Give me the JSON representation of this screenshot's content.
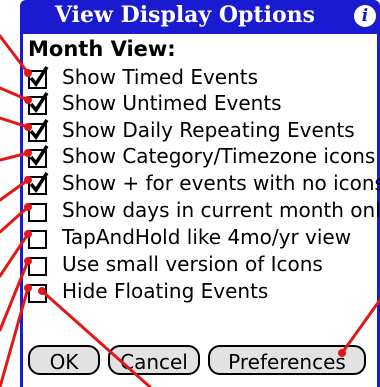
{
  "dialog": {
    "title": "View Display Options",
    "info_glyph": "i",
    "section_label": "Month View:"
  },
  "options": [
    {
      "label": "Show Timed Events",
      "checked": true
    },
    {
      "label": "Show Untimed Events",
      "checked": true
    },
    {
      "label": "Show Daily Repeating Events",
      "checked": true
    },
    {
      "label": "Show Category/Timezone icons",
      "checked": true
    },
    {
      "label": "Show + for events with no icons",
      "checked": true
    },
    {
      "label": "Show days in current month only",
      "checked": false
    },
    {
      "label": "TapAndHold like 4mo/yr view",
      "checked": false
    },
    {
      "label": "Use small version of Icons",
      "checked": false
    },
    {
      "label": "Hide Floating Events",
      "checked": false
    }
  ],
  "buttons": {
    "ok": "OK",
    "cancel": "Cancel",
    "preferences": "Preferences"
  },
  "colors": {
    "titlebar": "#1a1ad0",
    "callout": "#e01818"
  }
}
